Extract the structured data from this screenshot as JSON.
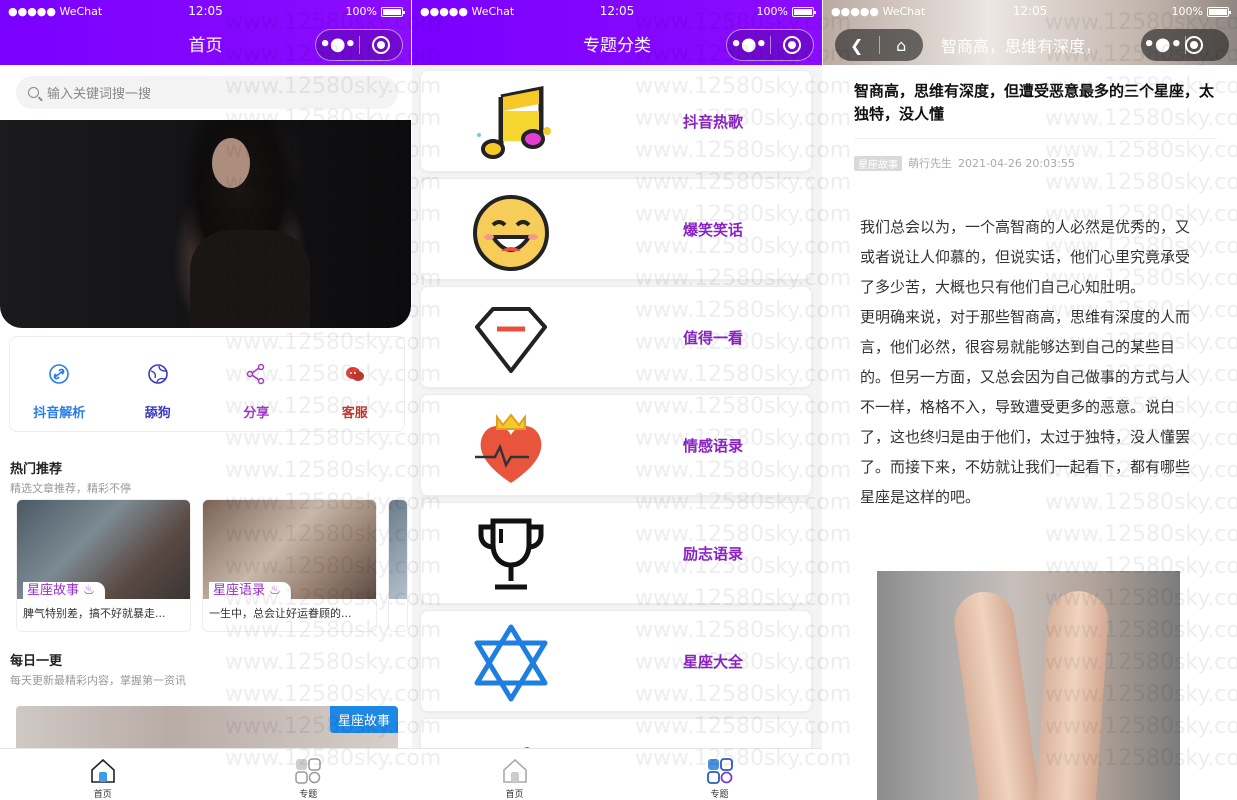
{
  "status": {
    "carrier": "●●●●● WeChat",
    "time": "12:05",
    "battery": "100%"
  },
  "capsule": {
    "more": "•●•"
  },
  "home": {
    "title": "首页",
    "search_placeholder": "输入关键词搜一搜",
    "quick": [
      {
        "label": "抖音解析",
        "icon": "link-icon",
        "color": "#2b7de9"
      },
      {
        "label": "舔狗",
        "icon": "globe-icon",
        "color": "#3a3ac2"
      },
      {
        "label": "分享",
        "icon": "share-icon",
        "color": "#a13bc9"
      },
      {
        "label": "客服",
        "icon": "chat-icon",
        "color": "#c2382f"
      }
    ],
    "hot_title": "热门推荐",
    "hot_sub": "精选文章推荐，精彩不停",
    "cards": [
      {
        "tag": "星座故事",
        "desc": "脾气特别差，搞不好就暴走..."
      },
      {
        "tag": "星座语录",
        "desc": "一生中，总会让好运眷顾的..."
      }
    ],
    "daily_title": "每日一更",
    "daily_sub": "每天更新最精彩内容，掌握第一资讯",
    "daily_tag": "星座故事"
  },
  "tabs": [
    {
      "label": "首页"
    },
    {
      "label": "专题"
    }
  ],
  "topics": {
    "title": "专题分类",
    "items": [
      {
        "label": "抖音热歌",
        "icon": "music-note-icon"
      },
      {
        "label": "爆笑笑话",
        "icon": "laughing-face-icon"
      },
      {
        "label": "值得一看",
        "icon": "diamond-icon"
      },
      {
        "label": "情感语录",
        "icon": "heart-crown-icon"
      },
      {
        "label": "励志语录",
        "icon": "trophy-icon"
      },
      {
        "label": "星座大全",
        "icon": "star-of-david-icon"
      }
    ]
  },
  "article": {
    "nav_title": "智商高，思维有深度，",
    "title": "智商高，思维有深度，但遭受恶意最多的三个星座，太独特，没人懂",
    "badge": "星座故事",
    "author": "萌行先生",
    "date": "2021-04-26 20:03:55",
    "paragraphs": [
      "我们总会以为，一个高智商的人必然是优秀的，又或者说让人仰慕的，但说实话，他们心里究竟承受了多少苦，大概也只有他们自己心知肚明。",
      "更明确来说，对于那些智商高，思维有深度的人而言，他们必然，很容易就能够达到自己的某些目的。但另一方面，又总会因为自己做事的方式与人不一样，格格不入，导致遭受更多的恶意。说白了，这也终归是由于他们，太过于独特，没人懂罢了。而接下来，不妨就让我们一起看下，都有哪些星座是这样的吧。"
    ]
  },
  "watermark": "www.12580sky.com"
}
